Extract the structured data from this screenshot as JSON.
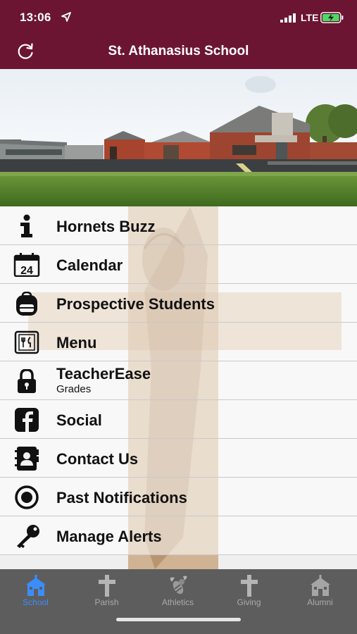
{
  "status_bar": {
    "time": "13:06",
    "network": "LTE"
  },
  "header": {
    "title": "St. Athanasius School"
  },
  "menu": {
    "items": [
      {
        "label": "Hornets Buzz",
        "icon": "info-icon"
      },
      {
        "label": "Calendar",
        "icon": "calendar-icon",
        "icon_text": "24"
      },
      {
        "label": "Prospective Students",
        "icon": "backpack-icon"
      },
      {
        "label": "Menu",
        "icon": "food-menu-icon"
      },
      {
        "label": "TeacherEase",
        "sublabel": "Grades",
        "icon": "lock-icon"
      },
      {
        "label": "Social",
        "icon": "facebook-icon"
      },
      {
        "label": "Contact Us",
        "icon": "contact-book-icon"
      },
      {
        "label": "Past Notifications",
        "icon": "radio-target-icon"
      },
      {
        "label": "Manage Alerts",
        "icon": "key-icon"
      }
    ]
  },
  "tabs": [
    {
      "label": "School",
      "icon": "school-icon",
      "active": true
    },
    {
      "label": "Parish",
      "icon": "cross-icon",
      "active": false
    },
    {
      "label": "Athletics",
      "icon": "hornet-icon",
      "active": false
    },
    {
      "label": "Giving",
      "icon": "cross-icon",
      "active": false
    },
    {
      "label": "Alumni",
      "icon": "school-icon",
      "active": false
    }
  ],
  "colors": {
    "header_bg": "#6b1532",
    "tabbar_bg": "#5d5d5d",
    "tab_active": "#3b8dfd",
    "tab_inactive": "#aaaaaa",
    "battery_fill": "#4cd964"
  }
}
